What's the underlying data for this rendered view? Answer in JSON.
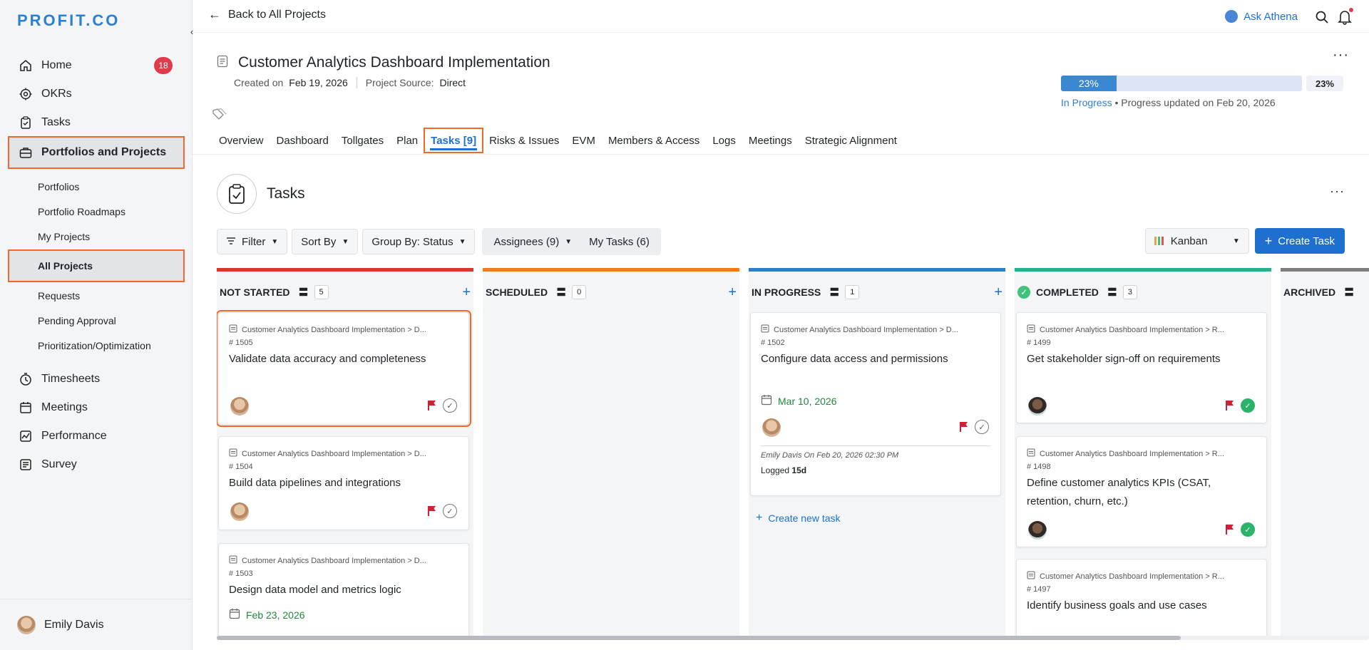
{
  "brand": {
    "logo_text": "PROFIT.CO",
    "accent": "#1f6fd1",
    "highlight": "#ef6a2a"
  },
  "sidebar": {
    "items": [
      {
        "label": "Home",
        "icon": "home-icon",
        "badge": "18"
      },
      {
        "label": "OKRs",
        "icon": "target-icon"
      },
      {
        "label": "Tasks",
        "icon": "clipboard-icon"
      },
      {
        "label": "Portfolios and Projects",
        "icon": "briefcase-icon",
        "active": true
      }
    ],
    "sub_items": [
      {
        "label": "Portfolios"
      },
      {
        "label": "Portfolio Roadmaps"
      },
      {
        "label": "My Projects"
      },
      {
        "label": "All Projects",
        "active": true
      },
      {
        "label": "Requests"
      },
      {
        "label": "Pending Approval"
      },
      {
        "label": "Prioritization/Optimization"
      }
    ],
    "bottom_items": [
      {
        "label": "Timesheets",
        "icon": "clock-icon"
      },
      {
        "label": "Meetings",
        "icon": "calendar-icon"
      },
      {
        "label": "Performance",
        "icon": "chart-icon"
      },
      {
        "label": "Survey",
        "icon": "survey-icon"
      }
    ],
    "user": {
      "name": "Emily Davis"
    }
  },
  "topbar": {
    "back_label": "Back to All Projects",
    "ask_label": "Ask Athena"
  },
  "project": {
    "title": "Customer Analytics Dashboard Implementation",
    "created_label": "Created on",
    "created_value": "Feb 19, 2026",
    "source_label": "Project Source:",
    "source_value": "Direct",
    "progress": {
      "percent": 23,
      "bar_label": "23%",
      "pct_label": "23%",
      "status": "In Progress",
      "updated": " • Progress updated on Feb 20, 2026"
    }
  },
  "tabs": [
    {
      "label": "Overview"
    },
    {
      "label": "Dashboard"
    },
    {
      "label": "Tollgates"
    },
    {
      "label": "Plan"
    },
    {
      "label": "Tasks [9]",
      "active": true
    },
    {
      "label": "Risks & Issues"
    },
    {
      "label": "EVM"
    },
    {
      "label": "Members & Access"
    },
    {
      "label": "Logs"
    },
    {
      "label": "Meetings"
    },
    {
      "label": "Strategic Alignment"
    }
  ],
  "tasks_section": {
    "title": "Tasks"
  },
  "toolbar": {
    "filter_label": "Filter",
    "sort_label": "Sort By",
    "group_label": "Group By: Status",
    "assignees_label": "Assignees (9)",
    "my_tasks_label": "My Tasks (6)",
    "view_label": "Kanban",
    "create_label": "Create Task"
  },
  "columns": [
    {
      "name": "NOT STARTED",
      "count": "5",
      "color": "#d7372b"
    },
    {
      "name": "SCHEDULED",
      "count": "0",
      "color": "#ef7d1a"
    },
    {
      "name": "IN PROGRESS",
      "count": "1",
      "color": "#2f7fc6"
    },
    {
      "name": "COMPLETED",
      "count": "3",
      "color": "#23b28a"
    },
    {
      "name": "ARCHIVED",
      "count": "",
      "color": "#7d7d7d"
    }
  ],
  "cards": {
    "not_started": [
      {
        "path": "Customer Analytics Dashboard Implementation > D...",
        "num": "# 1505",
        "title": "Validate data accuracy and completeness"
      },
      {
        "path": "Customer Analytics Dashboard Implementation > D...",
        "num": "# 1504",
        "title": "Build data pipelines and integrations"
      },
      {
        "path": "Customer Analytics Dashboard Implementation > D...",
        "num": "# 1503",
        "title": "Design data model and metrics logic",
        "date": "Feb 23, 2026"
      }
    ],
    "in_progress": [
      {
        "path": "Customer Analytics Dashboard Implementation > D...",
        "num": "# 1502",
        "title": "Configure data access and permissions",
        "date": "Mar 10, 2026",
        "log_meta": "Emily Davis On Feb 20, 2026 02:30 PM",
        "logged_label": "Logged",
        "logged_value": "15d"
      }
    ],
    "completed": [
      {
        "path": "Customer Analytics Dashboard Implementation > R...",
        "num": "# 1499",
        "title": "Get stakeholder sign-off on requirements"
      },
      {
        "path": "Customer Analytics Dashboard Implementation > R...",
        "num": "# 1498",
        "title": "Define customer analytics KPIs (CSAT, retention, churn, etc.)"
      },
      {
        "path": "Customer Analytics Dashboard Implementation > R...",
        "num": "# 1497",
        "title": "Identify business goals and use cases"
      }
    ]
  },
  "create_new_label": "Create new task"
}
